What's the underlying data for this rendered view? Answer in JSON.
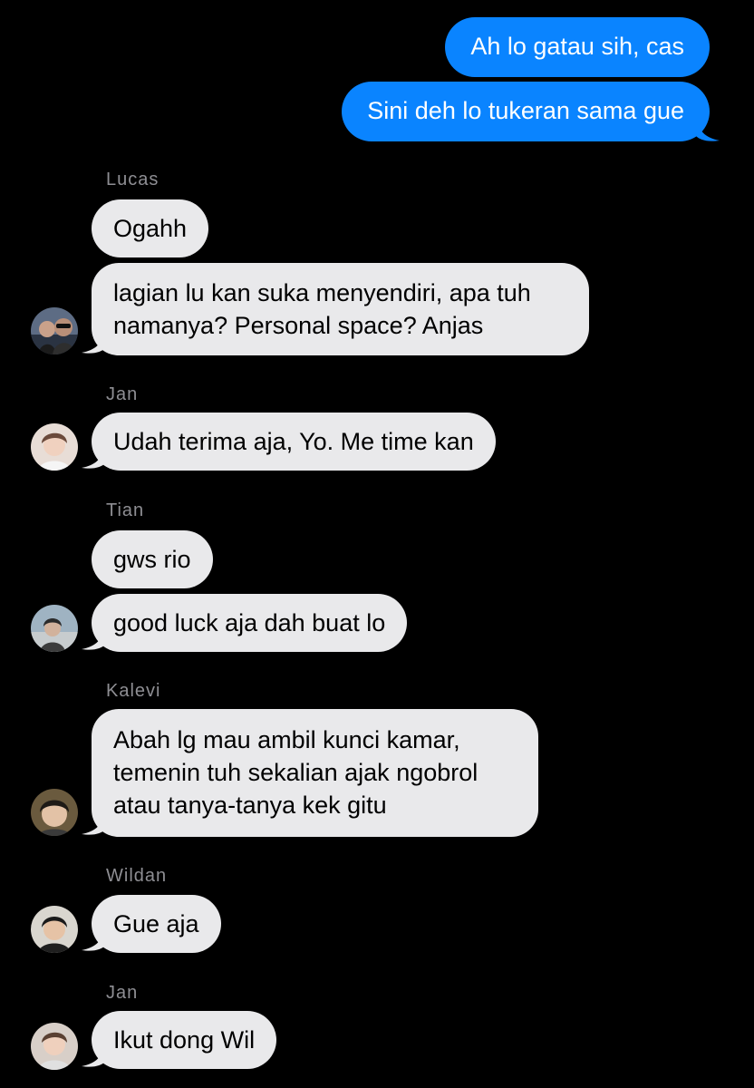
{
  "messages": {
    "outgoing": [
      {
        "text": "Ah lo gatau sih, cas"
      },
      {
        "text": "Sini deh lo tukeran sama gue"
      }
    ],
    "lucas": {
      "sender": "Lucas",
      "lines": [
        "Ogahh",
        "lagian lu kan suka menyendiri, apa tuh",
        "namanya? Personal space? Anjas"
      ]
    },
    "jan1": {
      "sender": "Jan",
      "lines": [
        "Udah terima aja, Yo. Me time kan"
      ]
    },
    "tian": {
      "sender": "Tian",
      "lines": [
        "gws rio",
        "good luck aja dah buat lo"
      ]
    },
    "kalevi": {
      "sender": "Kalevi",
      "lines": [
        "Abah lg mau ambil kunci kamar,",
        "temenin tuh sekalian ajak ngobrol",
        "atau tanya-tanya kek gitu"
      ]
    },
    "wildan": {
      "sender": "Wildan",
      "lines": [
        "Gue aja"
      ]
    },
    "jan2": {
      "sender": "Jan",
      "lines": [
        "Ikut dong Wil"
      ]
    }
  },
  "colors": {
    "background": "#000000",
    "outgoing_bubble": "#0a84ff",
    "incoming_bubble": "#e9e9eb",
    "sender_label": "#8e8e93"
  },
  "icons": [
    "avatar-lucas",
    "avatar-jan",
    "avatar-tian",
    "avatar-kalevi",
    "avatar-wildan",
    "avatar-jan"
  ]
}
